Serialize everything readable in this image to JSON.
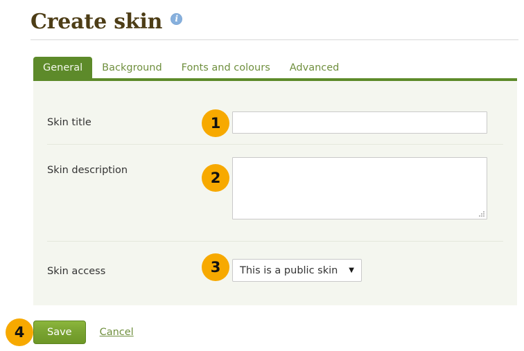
{
  "header": {
    "title": "Create skin",
    "info_icon": "info-icon",
    "info_glyph": "i"
  },
  "tabs": [
    {
      "label": "General",
      "active": true
    },
    {
      "label": "Background",
      "active": false
    },
    {
      "label": "Fonts and colours",
      "active": false
    },
    {
      "label": "Advanced",
      "active": false
    }
  ],
  "form": {
    "fields": [
      {
        "label": "Skin title",
        "type": "text",
        "value": "",
        "badge": "1"
      },
      {
        "label": "Skin description",
        "type": "textarea",
        "value": "",
        "badge": "2"
      },
      {
        "label": "Skin access",
        "type": "select",
        "value": "This is a public skin",
        "arrow_glyph": "▼",
        "badge": "3"
      }
    ]
  },
  "actions": {
    "badge": "4",
    "save_label": "Save",
    "cancel_label": "Cancel"
  },
  "colors": {
    "tab_active_bg": "#5d8a2a",
    "tab_text": "#6f8f3e",
    "panel_bg": "#f4f6ef",
    "badge_bg": "#f7a900",
    "title_text": "#4d3d16",
    "save_button": "#7aa432",
    "info_icon": "#87b0dd"
  }
}
